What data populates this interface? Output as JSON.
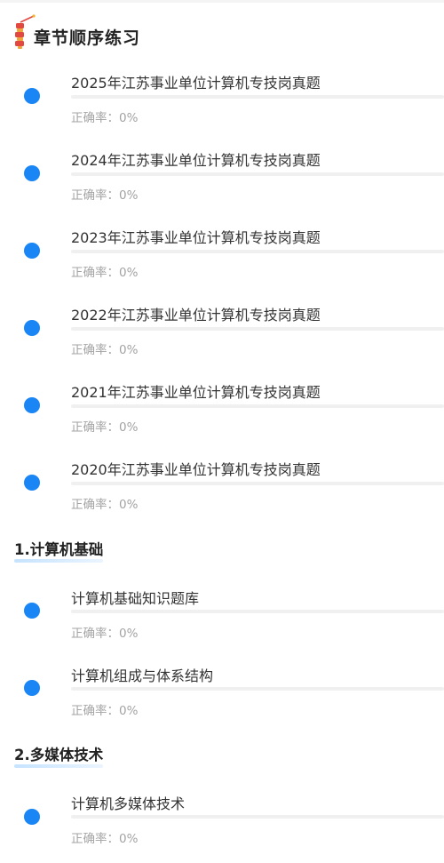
{
  "header": {
    "title": "章节顺序练习"
  },
  "groups": [
    {
      "section": "",
      "items": [
        {
          "title": "2025年江苏事业单位计算机专技岗真题",
          "accuracy_label": "正确率：0%",
          "progress": 0
        },
        {
          "title": "2024年江苏事业单位计算机专技岗真题",
          "accuracy_label": "正确率：0%",
          "progress": 0
        },
        {
          "title": "2023年江苏事业单位计算机专技岗真题",
          "accuracy_label": "正确率：0%",
          "progress": 0
        },
        {
          "title": "2022年江苏事业单位计算机专技岗真题",
          "accuracy_label": "正确率：0%",
          "progress": 0
        },
        {
          "title": "2021年江苏事业单位计算机专技岗真题",
          "accuracy_label": "正确率：0%",
          "progress": 0
        },
        {
          "title": "2020年江苏事业单位计算机专技岗真题",
          "accuracy_label": "正确率：0%",
          "progress": 0
        }
      ]
    },
    {
      "section": "1.计算机基础",
      "items": [
        {
          "title": "计算机基础知识题库",
          "accuracy_label": "正确率：0%",
          "progress": 0
        },
        {
          "title": "计算机组成与体系结构",
          "accuracy_label": "正确率：0%",
          "progress": 0
        }
      ]
    },
    {
      "section": "2.多媒体技术",
      "items": [
        {
          "title": "计算机多媒体技术",
          "accuracy_label": "正确率：0%",
          "progress": 0
        }
      ]
    }
  ],
  "colors": {
    "accent": "#1a85f5",
    "muted_text": "#a3a3a3",
    "track": "#f0f0f0"
  },
  "icons": {
    "header": "firecracker-icon",
    "item_marker": "blue-dot"
  }
}
